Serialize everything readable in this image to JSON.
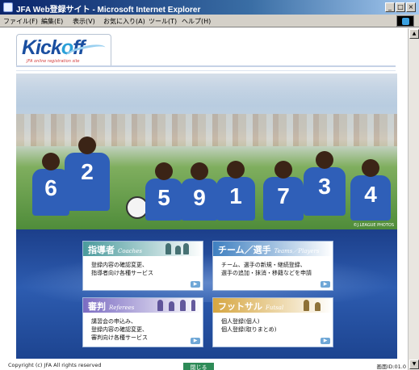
{
  "window": {
    "title": "JFA Web登録サイト - Microsoft Internet Explorer",
    "minimize": "_",
    "maximize": "□",
    "close": "×"
  },
  "menu": {
    "items": [
      "ファイル(F)",
      "編集(E)",
      "表示(V)",
      "お気に入り(A)",
      "ツール(T)",
      "ヘルプ(H)"
    ]
  },
  "logo": {
    "text_a": "Kick",
    "text_o": "o",
    "text_b": "ff",
    "sub": "JFA online registration site"
  },
  "photo": {
    "numbers": [
      "6",
      "2",
      "5",
      "9",
      "1",
      "7",
      "3",
      "4"
    ],
    "credit": "©J.LEAGUE PHOTOS"
  },
  "cards": {
    "coaches": {
      "title": "指導者",
      "sub": "Coaches",
      "lines": [
        "登録内容の確認変更、",
        "指導者向け各種サービス"
      ],
      "color": "#4a9a9c"
    },
    "teams": {
      "title": "チーム／選手",
      "sub": "Teams／Players",
      "lines": [
        "チーム、選手の新規・継続登録、",
        "選手の追加・抹消・移籍などを申請"
      ],
      "color": "#3e7fc0"
    },
    "referees": {
      "title": "審判",
      "sub": "Referees",
      "lines": [
        "講習会の申込み、",
        "登録内容の確認変更、",
        "審判向け各種サービス"
      ],
      "color": "#7b6cc2"
    },
    "futsal": {
      "title": "フットサル",
      "sub": "Futsal",
      "lines": [
        "個人登録(個人)",
        "個人登録(取りまとめ)"
      ],
      "color": "#d6a640"
    }
  },
  "close_button": "閉じる",
  "footer": {
    "copyright": "Copyright (c) JFA All rights reserved",
    "screen_id": "画面ID:01.0"
  }
}
